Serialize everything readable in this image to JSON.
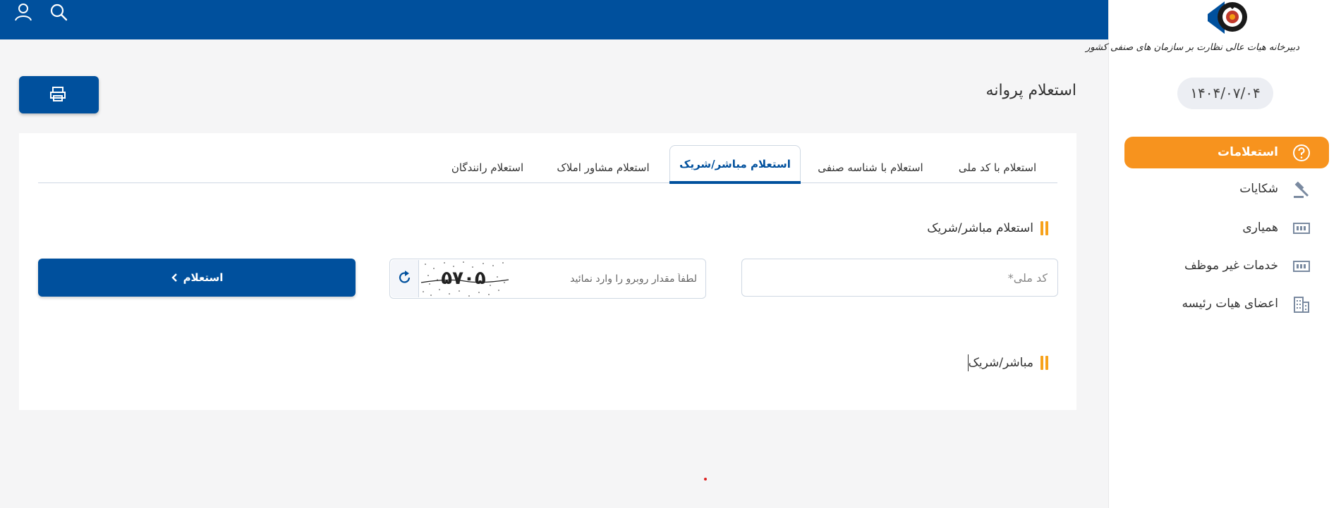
{
  "header": {
    "icons": [
      "user-icon",
      "search-icon"
    ],
    "background_color": "#00509d"
  },
  "sidebar": {
    "logo_text": "دبیرخانه هیات عالی نظارت بر سازمان های صنفی کشور",
    "date": "۱۴۰۴/۰۷/۰۴",
    "items": [
      {
        "label": "استعلامات",
        "icon": "question-icon",
        "active": true
      },
      {
        "label": "شکایات",
        "icon": "gavel-icon",
        "active": false
      },
      {
        "label": "همیاری",
        "icon": "money-icon",
        "active": false
      },
      {
        "label": "خدمات غیر موظف",
        "icon": "money-icon",
        "active": false
      },
      {
        "label": "اعضای هیات رئیسه",
        "icon": "building-icon",
        "active": false
      }
    ],
    "accent_color": "#f7931e"
  },
  "main": {
    "title": "استعلام پروانه",
    "print_icon": "print-icon",
    "tabs": [
      {
        "label": "استعلام با کد ملی",
        "active": false
      },
      {
        "label": "استعلام با شناسه صنفی",
        "active": false
      },
      {
        "label": "استعلام مباشر/شریک",
        "active": true
      },
      {
        "label": "استعلام مشاور املاک",
        "active": false
      },
      {
        "label": "استعلام رانندگان",
        "active": false
      }
    ],
    "form_section_title": "استعلام مباشر/شریک",
    "national_code_placeholder": "کد ملی*",
    "captcha_placeholder": "لطفاً مقدار روبرو را وارد نمائید",
    "captcha_text": "۵۷۰۵",
    "submit_label": "استعلام",
    "result_section_title": "مباشر/شریک"
  }
}
